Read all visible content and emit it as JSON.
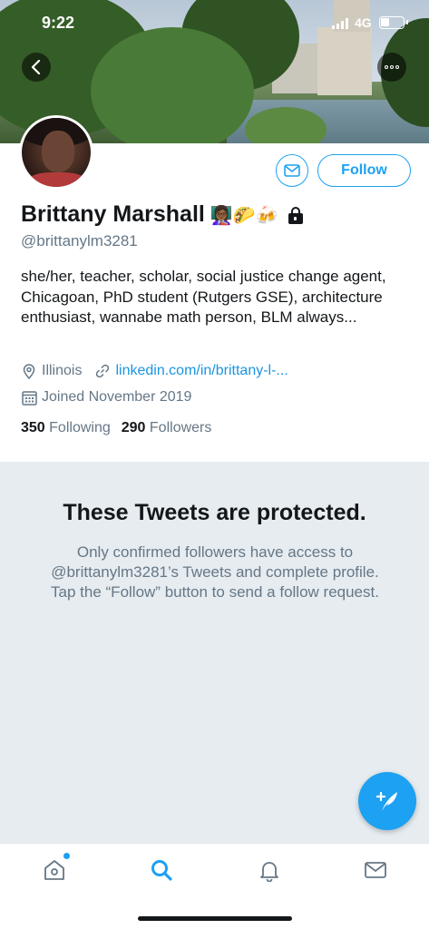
{
  "status_bar": {
    "time": "9:22",
    "network": "4G"
  },
  "profile": {
    "name": "Brittany Marshall",
    "name_emojis": "👩🏾‍🏫🌮🍻",
    "handle": "@brittanylm3281",
    "bio": "she/her, teacher, scholar, social justice change agent, Chicagoan, PhD student (Rutgers GSE), architecture enthusiast, wannabe math person, BLM always...",
    "location": "Illinois",
    "website": "linkedin.com/in/brittany-l-...",
    "joined": "Joined November 2019",
    "following_count": "350",
    "following_label": "Following",
    "followers_count": "290",
    "followers_label": "Followers",
    "locked": true
  },
  "actions": {
    "follow_label": "Follow"
  },
  "protected": {
    "title": "These Tweets are protected.",
    "body": "Only confirmed followers have access to @brittanylm3281’s Tweets and complete profile. Tap the “Follow” button to send a follow request."
  },
  "tabbar": {
    "active_tab": "search",
    "home_has_notification": true
  },
  "colors": {
    "accent": "#1da1f2",
    "secondary_text": "#657786",
    "protected_bg": "#e6ecf0"
  },
  "icons": [
    "back-arrow-icon",
    "more-icon",
    "mail-icon",
    "lock-icon",
    "location-pin-icon",
    "link-icon",
    "calendar-icon",
    "compose-tweet-icon",
    "home-icon",
    "search-icon",
    "bell-icon",
    "envelope-icon"
  ]
}
